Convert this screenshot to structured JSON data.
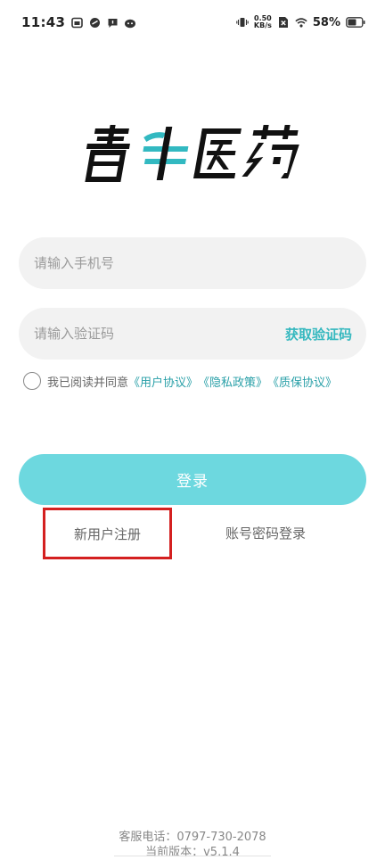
{
  "status_bar": {
    "time": "11:43",
    "net_speed_value": "0.50",
    "net_speed_unit": "KB/s",
    "battery": "58%"
  },
  "logo": {
    "text": "青牛医药",
    "colors": {
      "dark": "#111111",
      "accent": "#32b9c1"
    }
  },
  "form": {
    "phone_placeholder": "请输入手机号",
    "code_placeholder": "请输入验证码",
    "get_code_label": "获取验证码",
    "agreement": {
      "prefix": "我已阅读并同意",
      "user_agreement": "《用户协议》",
      "privacy_policy": "《隐私政策》",
      "warranty_agreement": "《质保协议》"
    },
    "login_label": "登录"
  },
  "links": {
    "register": "新用户注册",
    "password_login": "账号密码登录"
  },
  "footer": {
    "service_phone": "客服电话：0797-730-2078",
    "version": "当前版本：v5.1.4"
  },
  "colors": {
    "accent": "#35b8bf",
    "login_button": "#6dd8df",
    "input_bg": "#f2f2f2",
    "highlight_border": "#d42020"
  }
}
